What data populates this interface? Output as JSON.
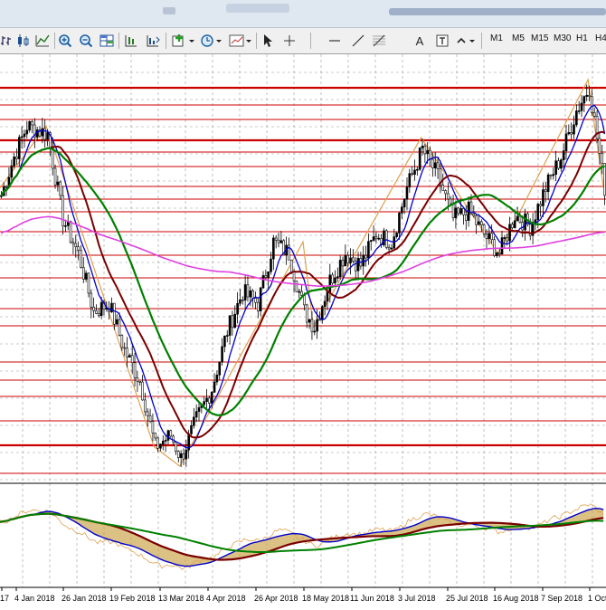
{
  "toolbar": {
    "timeframes": [
      "M1",
      "M5",
      "M15",
      "M30",
      "H1",
      "H4"
    ],
    "text_tool_label": "A"
  },
  "colors": {
    "bull_candle": "#000000",
    "bear_candle": "#ffffff",
    "ma_fast": "#0000cc",
    "ma_mid": "#7a0000",
    "ma_slow": "#008000",
    "ma_long": "#e040e0",
    "level_lines": "#cc0000",
    "zigzag": "#e0a050",
    "cloud_fill": "#c8a040"
  },
  "chart_data": {
    "type": "candlestick",
    "x_labels": [
      "17",
      "4 Jan 2018",
      "26 Jan 2018",
      "19 Feb 2018",
      "13 Mar 2018",
      "4 Apr 2018",
      "26 Apr 2018",
      "18 May 2018",
      "11 Jun 2018",
      "3 Jul 2018",
      "25 Jul 2018",
      "16 Aug 2018",
      "7 Sep 2018",
      "1 Oct"
    ],
    "price_path_keypoints": [
      [
        0,
        0.7
      ],
      [
        5,
        0.8
      ],
      [
        10,
        0.88
      ],
      [
        18,
        0.86
      ],
      [
        24,
        0.64
      ],
      [
        30,
        0.55
      ],
      [
        36,
        0.4
      ],
      [
        42,
        0.42
      ],
      [
        48,
        0.3
      ],
      [
        54,
        0.22
      ],
      [
        60,
        0.05
      ],
      [
        66,
        0.08
      ],
      [
        70,
        0.02
      ],
      [
        76,
        0.12
      ],
      [
        82,
        0.2
      ],
      [
        88,
        0.35
      ],
      [
        94,
        0.45
      ],
      [
        100,
        0.42
      ],
      [
        106,
        0.58
      ],
      [
        112,
        0.55
      ],
      [
        118,
        0.4
      ],
      [
        122,
        0.36
      ],
      [
        128,
        0.48
      ],
      [
        134,
        0.55
      ],
      [
        140,
        0.52
      ],
      [
        146,
        0.6
      ],
      [
        152,
        0.58
      ],
      [
        158,
        0.72
      ],
      [
        164,
        0.82
      ],
      [
        170,
        0.75
      ],
      [
        176,
        0.64
      ],
      [
        182,
        0.66
      ],
      [
        188,
        0.6
      ],
      [
        194,
        0.55
      ],
      [
        200,
        0.65
      ],
      [
        206,
        0.62
      ],
      [
        212,
        0.72
      ],
      [
        218,
        0.8
      ],
      [
        224,
        0.92
      ],
      [
        229,
        0.98
      ],
      [
        235,
        0.72
      ]
    ],
    "indicator": {
      "type": "oscillator_cloud"
    }
  }
}
